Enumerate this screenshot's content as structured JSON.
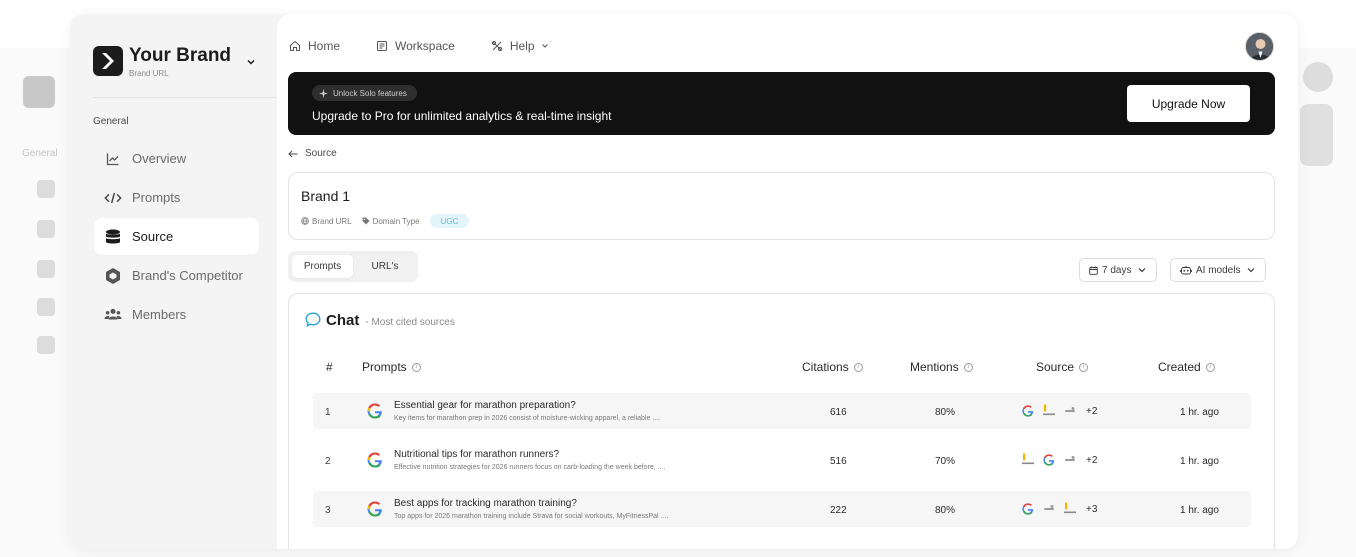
{
  "colors": {
    "accent": "#2aa3d6",
    "banner_bg": "#111111",
    "badge_bg": "#e3f5fb",
    "badge_text": "#5cc0dc"
  },
  "sidebar": {
    "brand_name": "Your Brand",
    "brand_url": "Brand URL",
    "section_label": "General",
    "items": [
      {
        "label": "Overview",
        "icon": "chart-line-icon"
      },
      {
        "label": "Prompts",
        "icon": "code-icon"
      },
      {
        "label": "Source",
        "icon": "database-icon"
      },
      {
        "label": "Brand's Competitor",
        "icon": "hexagon-icon"
      },
      {
        "label": "Members",
        "icon": "users-icon"
      }
    ]
  },
  "topnav": {
    "home": "Home",
    "workspace": "Workspace",
    "help": "Help"
  },
  "banner": {
    "pill": "Unlock Solo features",
    "text": "Upgrade to Pro for unlimited analytics & real-time insight",
    "button": "Upgrade Now"
  },
  "breadcrumb": {
    "back_label": "Source"
  },
  "brand_card": {
    "title": "Brand 1",
    "url_label": "Brand URL",
    "domain_label": "Domain Type",
    "badge": "UGC"
  },
  "tabs": [
    "Prompts",
    "URL's"
  ],
  "filters": {
    "days": "7 days",
    "models": "AI models"
  },
  "table": {
    "title": "Chat",
    "subtitle": "- Most cited sources",
    "columns": {
      "num": "#",
      "prompts": "Prompts",
      "citations": "Citations",
      "mentions": "Mentions",
      "source": "Source",
      "created": "Created"
    },
    "rows": [
      {
        "num": "1",
        "title": "Essential gear for marathon preparation?",
        "desc": "Key items for marathon prep in 2026 consist of moisture-wicking apparel, a reliable ....",
        "citations": "616",
        "mentions": "80%",
        "more": "+2",
        "created": "1 hr. ago"
      },
      {
        "num": "2",
        "title": "Nutritional tips for marathon runners?",
        "desc": "Effective nutrition strategies for 2026 runners focus on carb-loading the week before, ....",
        "citations": "516",
        "mentions": "70%",
        "more": "+2",
        "created": "1 hr. ago"
      },
      {
        "num": "3",
        "title": "Best apps for tracking marathon training?",
        "desc": "Top apps for 2026 marathon training include Strava for social workouts, MyFitnessPal ....",
        "citations": "222",
        "mentions": "80%",
        "more": "+3",
        "created": "1 hr. ago"
      }
    ]
  }
}
